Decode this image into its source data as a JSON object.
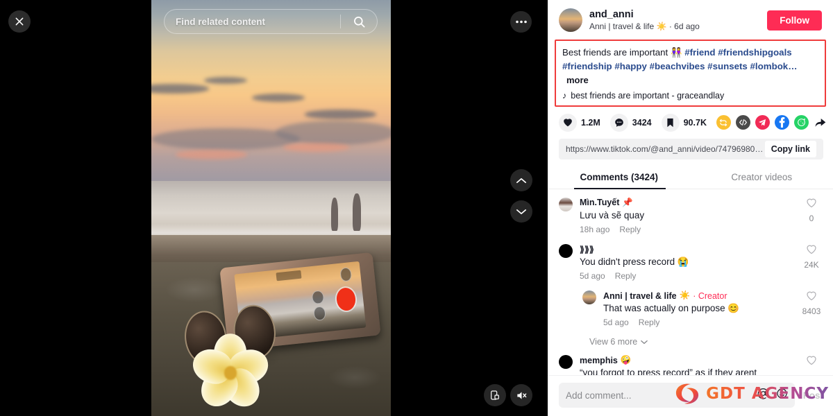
{
  "video": {
    "search_placeholder": "Find related content",
    "close_icon": "close-icon",
    "more_icon": "more-options-icon",
    "nav_up_icon": "chevron-up-icon",
    "nav_down_icon": "chevron-down-icon",
    "fit_icon": "fit-screen-icon",
    "mute_icon": "volume-muted-icon"
  },
  "author": {
    "username": "and_anni",
    "display_name": "Anni | travel & life",
    "emoji": "☀️",
    "separator": "·",
    "posted": "6d ago",
    "follow_label": "Follow",
    "follow_color": "#fe2c55"
  },
  "caption": {
    "text": "Best friends are important",
    "emoji": "👭",
    "hashtags": [
      "#friend",
      "#friendshipgoals",
      "#friendship",
      "#happy",
      "#beachvibes",
      "#sunsets",
      "#lombok…"
    ],
    "more_label": "more",
    "music_icon": "music-note-icon",
    "music": "best friends are important - graceandlay",
    "highlight_color": "#ef3b3b"
  },
  "stats": {
    "likes": "1.2M",
    "comments": "3424",
    "bookmarks": "90.7K",
    "like_icon": "heart-icon",
    "comment_icon": "comment-bubble-icon",
    "bookmark_icon": "bookmark-icon",
    "share": [
      {
        "name": "repost-icon",
        "color": "#fac032"
      },
      {
        "name": "embed-code-icon",
        "color": "#4a4a4a"
      },
      {
        "name": "telegram-icon",
        "color": "#f12b56"
      },
      {
        "name": "facebook-icon",
        "color": "#1877f2"
      },
      {
        "name": "whatsapp-icon",
        "color": "#25d366"
      },
      {
        "name": "share-arrow-icon",
        "color": "#161823"
      }
    ]
  },
  "link": {
    "url": "https://www.tiktok.com/@and_anni/video/747969804…",
    "copy_label": "Copy link"
  },
  "tabs": [
    {
      "label": "Comments (3424)",
      "active": true
    },
    {
      "label": "Creator videos",
      "active": false
    }
  ],
  "comments": [
    {
      "user": "Mìn.Tuyết",
      "emoji": "📌",
      "text": "Lưu và sẽ quay",
      "time": "18h ago",
      "reply_label": "Reply",
      "likes": "0",
      "avatar": "girl",
      "is_reply": false,
      "is_creator": false
    },
    {
      "user": "⟫⟫⟫",
      "emoji": "",
      "text": "You didn't press record 😭",
      "time": "5d ago",
      "reply_label": "Reply",
      "likes": "24K",
      "avatar": "dark",
      "is_reply": false,
      "is_creator": false
    },
    {
      "user": "Anni | travel & life",
      "emoji": "☀️",
      "creator_label": "· Creator",
      "text": "That was actually on purpose 😊",
      "time": "5d ago",
      "reply_label": "Reply",
      "likes": "8403",
      "avatar": "author",
      "is_reply": true,
      "is_creator": true
    },
    {
      "user": "memphis",
      "emoji": "🤪",
      "text": "“you forgot to press record” as if they arent",
      "time": "",
      "reply_label": "",
      "likes": "",
      "avatar": "dark",
      "is_reply": false,
      "is_creator": false
    }
  ],
  "view_more": {
    "label": "View 6 more",
    "icon": "chevron-down-icon"
  },
  "compose": {
    "placeholder": "Add comment...",
    "mention_icon": "at-mention-icon",
    "emoji_icon": "emoji-icon",
    "post_label": "Post"
  },
  "watermark": {
    "text": "GDT AGENCY",
    "logo": "gdt-logo"
  }
}
